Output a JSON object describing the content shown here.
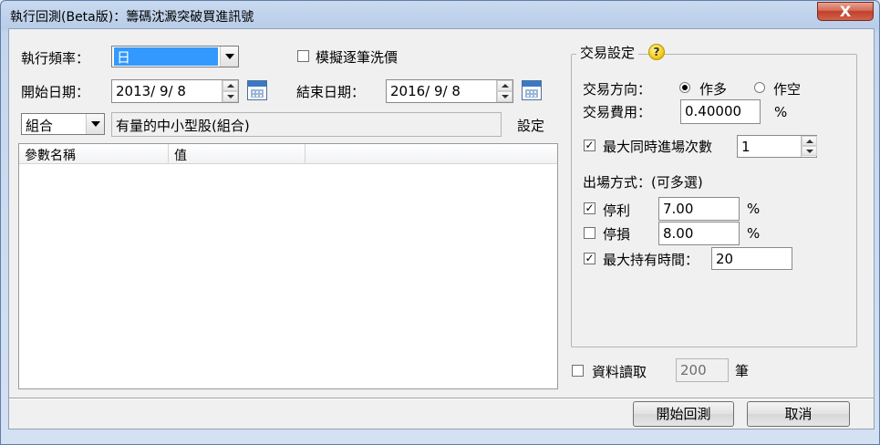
{
  "window": {
    "title": "執行回測(Beta版)：籌碼沈澱突破買進訊號",
    "close_glyph": "X"
  },
  "frequency": {
    "label": "執行頻率：",
    "value": "日"
  },
  "simulate": {
    "label": "模擬逐筆洗價",
    "checked": false
  },
  "start_date": {
    "label": "開始日期：",
    "value": "2013/  9/  8"
  },
  "end_date": {
    "label": "結束日期：",
    "value": "2016/  9/  8"
  },
  "portfolio": {
    "type_value": "組合",
    "name_value": "有量的中小型股(組合)",
    "settings_link": "設定"
  },
  "param_table": {
    "columns": [
      "參數名稱",
      "值",
      ""
    ],
    "rows": []
  },
  "trade_settings": {
    "title": "交易設定",
    "help_glyph": "?",
    "direction_label": "交易方向：",
    "direction_long": "作多",
    "direction_short": "作空",
    "direction_selected": "long",
    "fee_label": "交易費用：",
    "fee_value": "0.40000",
    "fee_unit": "%",
    "max_entries_label": "最大同時進場次數",
    "max_entries_checked": true,
    "max_entries_value": "1",
    "exit_label": "出場方式：(可多選)",
    "take_profit": {
      "label": "停利",
      "checked": true,
      "value": "7.00",
      "unit": "%"
    },
    "stop_loss": {
      "label": "停損",
      "checked": false,
      "value": "8.00",
      "unit": "%"
    },
    "max_hold": {
      "label": "最大持有時間：",
      "checked": true,
      "value": "20"
    }
  },
  "data_read": {
    "label": "資料讀取",
    "checked": false,
    "value": "200",
    "unit": "筆"
  },
  "buttons": {
    "start": "開始回測",
    "cancel": "取消"
  }
}
